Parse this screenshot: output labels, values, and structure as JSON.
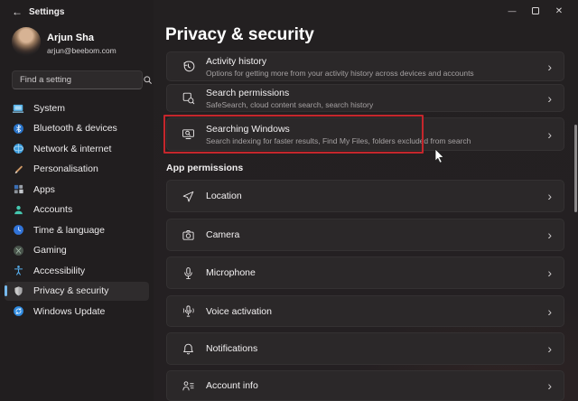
{
  "titlebar": {
    "app_title": "Settings",
    "back_glyph": "←",
    "minimize_glyph": "—",
    "close_glyph": "✕"
  },
  "profile": {
    "name": "Arjun Sha",
    "email": "arjun@beebom.com"
  },
  "search": {
    "placeholder": "Find a setting"
  },
  "sidebar": {
    "items": [
      {
        "label": "System"
      },
      {
        "label": "Bluetooth & devices"
      },
      {
        "label": "Network & internet"
      },
      {
        "label": "Personalisation"
      },
      {
        "label": "Apps"
      },
      {
        "label": "Accounts"
      },
      {
        "label": "Time & language"
      },
      {
        "label": "Gaming"
      },
      {
        "label": "Accessibility"
      },
      {
        "label": "Privacy & security",
        "selected": true
      },
      {
        "label": "Windows Update"
      }
    ]
  },
  "main": {
    "title": "Privacy & security",
    "chevron": "›",
    "security_cards": [
      {
        "title": "Activity history",
        "subtitle": "Options for getting more from your activity history across devices and accounts"
      },
      {
        "title": "Search permissions",
        "subtitle": "SafeSearch, cloud content search, search history"
      },
      {
        "title": "Searching Windows",
        "subtitle": "Search indexing for faster results, Find My Files, folders excluded from search"
      }
    ],
    "section_header": "App permissions",
    "permission_cards": [
      {
        "title": "Location"
      },
      {
        "title": "Camera"
      },
      {
        "title": "Microphone"
      },
      {
        "title": "Voice activation"
      },
      {
        "title": "Notifications"
      },
      {
        "title": "Account info"
      }
    ]
  },
  "colors": {
    "accent": "#76b9ed",
    "highlight_border": "#c5262c"
  }
}
